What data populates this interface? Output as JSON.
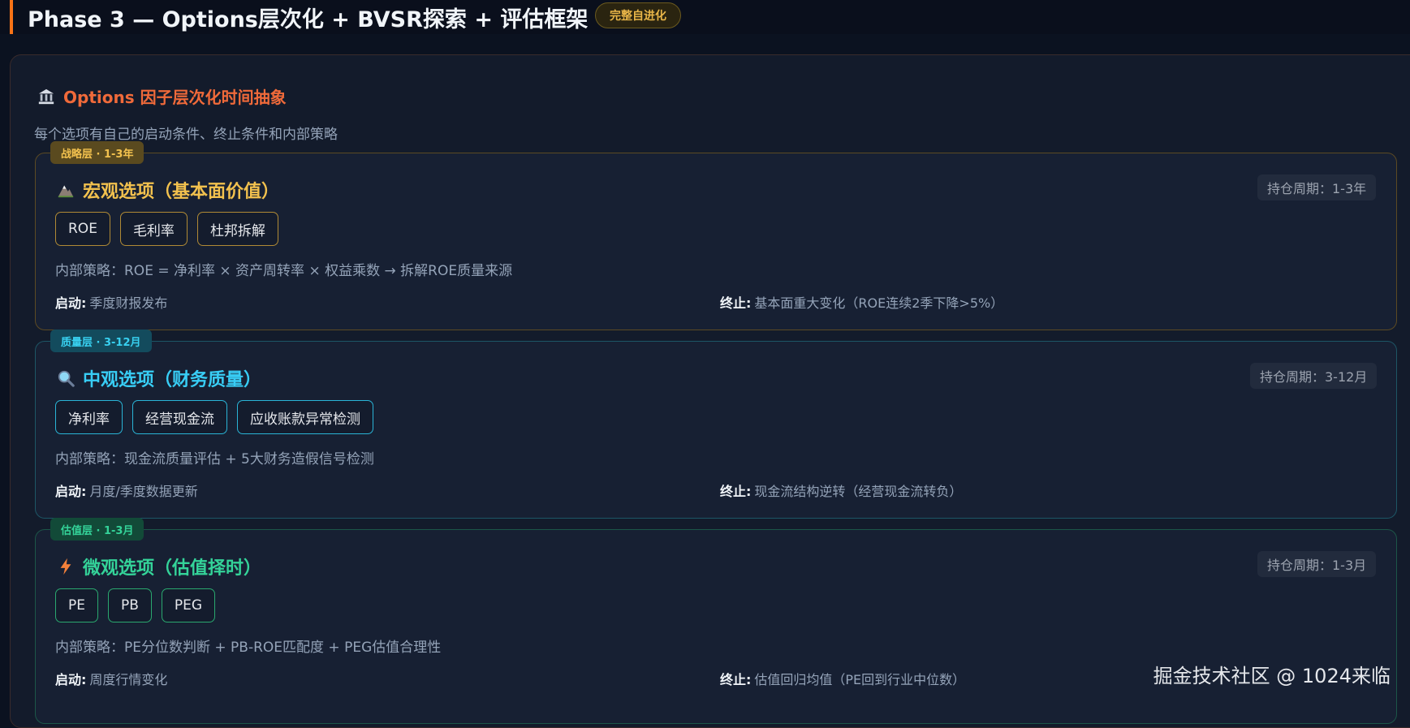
{
  "header": {
    "title": "Phase 3 — Options层次化 + BVSR探索 + 评估框架",
    "badge": "完整自进化"
  },
  "section": {
    "icon": "bank-building-icon",
    "heading": "Options 因子层次化时间抽象",
    "description": "每个选项有自己的启动条件、终止条件和内部策略"
  },
  "cards": [
    {
      "layer_tag": "战略层 · 1-3年",
      "icon": "mountain-icon",
      "title": "宏观选项（基本面价值）",
      "period": "持仓周期：1-3年",
      "chips": [
        "ROE",
        "毛利率",
        "杜邦拆解"
      ],
      "strategy": "内部策略：ROE = 净利率 × 资产周转率 × 权益乘数 → 拆解ROE质量来源",
      "start_label": "启动:",
      "start_value": "季度财报发布",
      "end_label": "终止:",
      "end_value": "基本面重大变化（ROE连续2季下降>5%）"
    },
    {
      "layer_tag": "质量层 · 3-12月",
      "icon": "magnifier-icon",
      "title": "中观选项（财务质量）",
      "period": "持仓周期：3-12月",
      "chips": [
        "净利率",
        "经营现金流",
        "应收账款异常检测"
      ],
      "strategy": "内部策略：现金流质量评估 + 5大财务造假信号检测",
      "start_label": "启动:",
      "start_value": "月度/季度数据更新",
      "end_label": "终止:",
      "end_value": "现金流结构逆转（经营现金流转负）"
    },
    {
      "layer_tag": "估值层 · 1-3月",
      "icon": "lightning-icon",
      "title": "微观选项（估值择时）",
      "period": "持仓周期：1-3月",
      "chips": [
        "PE",
        "PB",
        "PEG"
      ],
      "strategy": "内部策略：PE分位数判断 + PB-ROE匹配度 + PEG估值合理性",
      "start_label": "启动:",
      "start_value": "周度行情变化",
      "end_label": "终止:",
      "end_value": "估值回归均值（PE回到行业中位数）"
    }
  ],
  "watermark": "掘金技术社区 @ 1024来临",
  "colors": {
    "accent_orange": "#f06a3a",
    "gold": "#f2c14e",
    "cyan": "#38cdf5",
    "green": "#34d399"
  }
}
